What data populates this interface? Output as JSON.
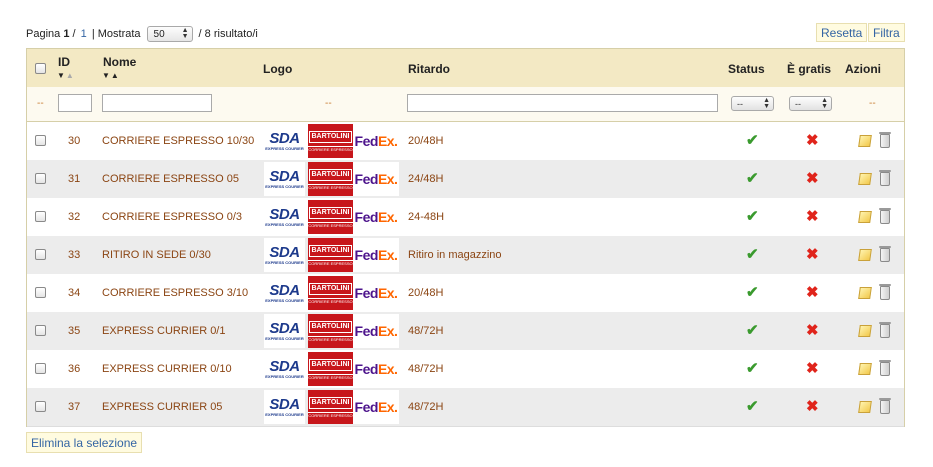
{
  "pagination": {
    "page_label": "Pagina",
    "current_page": "1",
    "separator": "/",
    "total_pages": "1",
    "pipe": "|",
    "show_label": "Mostrata",
    "show_value": "50",
    "results_text": "/ 8 risultato/i"
  },
  "buttons": {
    "reset": "Resetta",
    "filter": "Filtra",
    "bulk_delete": "Elimina la selezione"
  },
  "columns": {
    "id": "ID",
    "name": "Nome",
    "logo": "Logo",
    "delay": "Ritardo",
    "status": "Status",
    "free": "È gratis",
    "actions": "Azioni"
  },
  "filters": {
    "checkbox_placeholder": "--",
    "logo_placeholder": "--",
    "status_value": "--",
    "free_value": "--",
    "actions_placeholder": "--"
  },
  "logo_text": {
    "sda": "SDA",
    "sda_sub": "EXPRESS COURIER",
    "bartolini": "BARTOLINI",
    "bartolini_sub": "CORRIERE ESPRESSO",
    "fedex_fe": "Fed",
    "fedex_ex": "Ex."
  },
  "rows": [
    {
      "id": "30",
      "name": "CORRIERE ESPRESSO 10/30",
      "delay": "20/48H",
      "status": true,
      "free": false
    },
    {
      "id": "31",
      "name": "CORRIERE ESPRESSO 05",
      "delay": "24/48H",
      "status": true,
      "free": false
    },
    {
      "id": "32",
      "name": "CORRIERE ESPRESSO 0/3",
      "delay": "24-48H",
      "status": true,
      "free": false
    },
    {
      "id": "33",
      "name": "RITIRO IN SEDE 0/30",
      "delay": "Ritiro in magazzino",
      "status": true,
      "free": false
    },
    {
      "id": "34",
      "name": "CORRIERE ESPRESSO 3/10",
      "delay": "20/48H",
      "status": true,
      "free": false
    },
    {
      "id": "35",
      "name": "EXPRESS CURRIER 0/1",
      "delay": "48/72H",
      "status": true,
      "free": false
    },
    {
      "id": "36",
      "name": "EXPRESS CURRIER 0/10",
      "delay": "48/72H",
      "status": true,
      "free": false
    },
    {
      "id": "37",
      "name": "EXPRESS CURRIER 05",
      "delay": "48/72H",
      "status": true,
      "free": false
    }
  ],
  "icons": {
    "status_on": "check-icon",
    "free_off": "cross-icon",
    "edit": "pencil-icon",
    "delete": "trash-icon",
    "sort": "sort-arrows-icon"
  },
  "colors": {
    "header_bg": "#f3e9c4",
    "link_text": "#8b4513",
    "button_text": "#3465a4",
    "check": "#3a9a2e",
    "cross": "#e0241b"
  }
}
